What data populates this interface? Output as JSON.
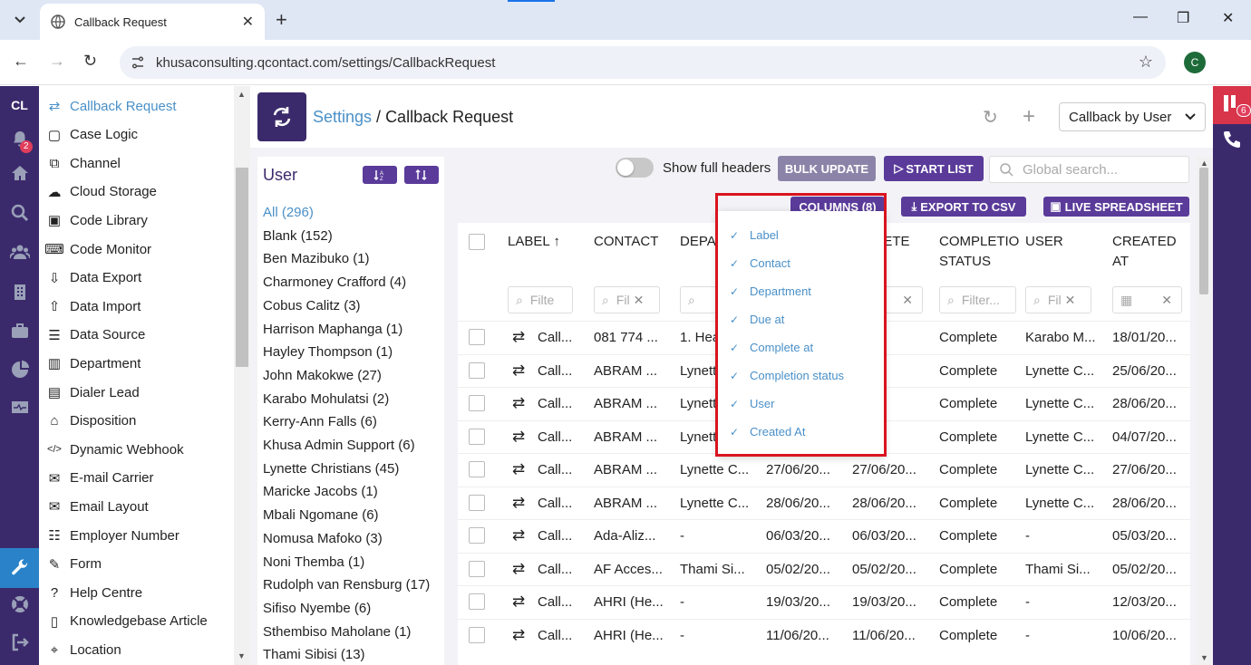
{
  "browser": {
    "tab_title": "Callback Request",
    "url": "khusaconsulting.qcontact.com/settings/CallbackRequest",
    "profile_initial": "C"
  },
  "rail": {
    "brand": "CL",
    "notification_count": "2"
  },
  "settings_menu": [
    {
      "label": "Callback Request",
      "icon": "refresh-icon"
    },
    {
      "label": "Case Logic",
      "icon": "square-icon"
    },
    {
      "label": "Channel",
      "icon": "external-icon"
    },
    {
      "label": "Cloud Storage",
      "icon": "cloud-icon"
    },
    {
      "label": "Code Library",
      "icon": "code-icon"
    },
    {
      "label": "Code Monitor",
      "icon": "keyboard-icon"
    },
    {
      "label": "Data Export",
      "icon": "export-icon"
    },
    {
      "label": "Data Import",
      "icon": "import-icon"
    },
    {
      "label": "Data Source",
      "icon": "database-icon"
    },
    {
      "label": "Department",
      "icon": "building-icon"
    },
    {
      "label": "Dialer Lead",
      "icon": "phone-list-icon"
    },
    {
      "label": "Disposition",
      "icon": "tag-icon"
    },
    {
      "label": "Dynamic Webhook",
      "icon": "code-slash-icon"
    },
    {
      "label": "E-mail Carrier",
      "icon": "mail-icon"
    },
    {
      "label": "Email Layout",
      "icon": "mail-layout-icon"
    },
    {
      "label": "Employer Number",
      "icon": "list-icon"
    },
    {
      "label": "Form",
      "icon": "edit-icon"
    },
    {
      "label": "Help Centre",
      "icon": "question-icon"
    },
    {
      "label": "Knowledgebase Article",
      "icon": "book-icon"
    },
    {
      "label": "Location",
      "icon": "pin-icon"
    }
  ],
  "header": {
    "crumb_link": "Settings",
    "crumb_sep": " / ",
    "crumb_current": "Callback Request",
    "view_select": "Callback by User"
  },
  "user_panel": {
    "title": "User",
    "items": [
      "All (296)",
      "Blank (152)",
      "Ben Mazibuko (1)",
      "Charmoney Crafford (4)",
      "Cobus Calitz (3)",
      "Harrison Maphanga (1)",
      "Hayley Thompson (1)",
      "John Makokwe (27)",
      "Karabo Mohulatsi (2)",
      "Kerry-Ann Falls (6)",
      "Khusa Admin Support (6)",
      "Lynette Christians (45)",
      "Maricke Jacobs (1)",
      "Mbali Ngomane (6)",
      "Nomusa Mafoko (3)",
      "Noni Themba (1)",
      "Rudolph van Rensburg (17)",
      "Sifiso Nyembe (6)",
      "Sthembiso Maholane (1)",
      "Thami Sibisi (13)"
    ]
  },
  "toolbar": {
    "show_full_headers": "Show full headers",
    "bulk_update": "BULK UPDATE",
    "start_list": "START LIST",
    "search_placeholder": "Global search...",
    "columns": "COLUMNS (8)",
    "export_csv": "EXPORT TO CSV",
    "live_spreadsheet": "LIVE SPREADSHEET"
  },
  "grid": {
    "headers": [
      "LABEL",
      "CONTACT",
      "DEPA",
      "",
      "PLETE",
      "COMPLETIO STATUS",
      "USER",
      "CREATED AT"
    ],
    "header_label": "LABEL",
    "header_contact": "CONTACT",
    "header_dept": "DEPA",
    "header_complete": "PLETE",
    "header_status_1": "COMPLETIO",
    "header_status_2": "STATUS",
    "header_user": "USER",
    "header_created_1": "CREATED",
    "header_created_2": "AT",
    "filter_placeholders": [
      "Filte",
      "Fil",
      "Filter...",
      "Fil"
    ],
    "rows": [
      [
        "Call...",
        "081 774 ...",
        "1. Hea",
        "",
        "/20...",
        "Complete",
        "Karabo M...",
        "18/01/20..."
      ],
      [
        "Call...",
        "ABRAM ...",
        "Lynett",
        "",
        "/20...",
        "Complete",
        "Lynette C...",
        "25/06/20..."
      ],
      [
        "Call...",
        "ABRAM ...",
        "Lynett",
        "",
        "/20...",
        "Complete",
        "Lynette C...",
        "28/06/20..."
      ],
      [
        "Call...",
        "ABRAM ...",
        "Lynett",
        "",
        "/20...",
        "Complete",
        "Lynette C...",
        "04/07/20..."
      ],
      [
        "Call...",
        "ABRAM ...",
        "Lynette C...",
        "27/06/20...",
        "27/06/20...",
        "Complete",
        "Lynette C...",
        "27/06/20..."
      ],
      [
        "Call...",
        "ABRAM ...",
        "Lynette C...",
        "28/06/20...",
        "28/06/20...",
        "Complete",
        "Lynette C...",
        "28/06/20..."
      ],
      [
        "Call...",
        "Ada-Aliz...",
        "-",
        "06/03/20...",
        "06/03/20...",
        "Complete",
        "-",
        "05/03/20..."
      ],
      [
        "Call...",
        "AF Acces...",
        "Thami Si...",
        "05/02/20...",
        "05/02/20...",
        "Complete",
        "Thami Si...",
        "05/02/20..."
      ],
      [
        "Call...",
        "AHRI (He...",
        "-",
        "19/03/20...",
        "19/03/20...",
        "Complete",
        "-",
        "12/03/20..."
      ],
      [
        "Call...",
        "AHRI (He...",
        "-",
        "11/06/20...",
        "11/06/20...",
        "Complete",
        "-",
        "10/06/20..."
      ]
    ]
  },
  "column_menu": [
    "Label",
    "Contact",
    "Department",
    "Due at",
    "Complete at",
    "Completion status",
    "User",
    "Created At"
  ],
  "right_rail": {
    "badge": "6"
  },
  "colors": {
    "brand": "#3b2a6b",
    "accent": "#5a3b9a",
    "link": "#4a90c8",
    "highlight": "#d9141f"
  }
}
